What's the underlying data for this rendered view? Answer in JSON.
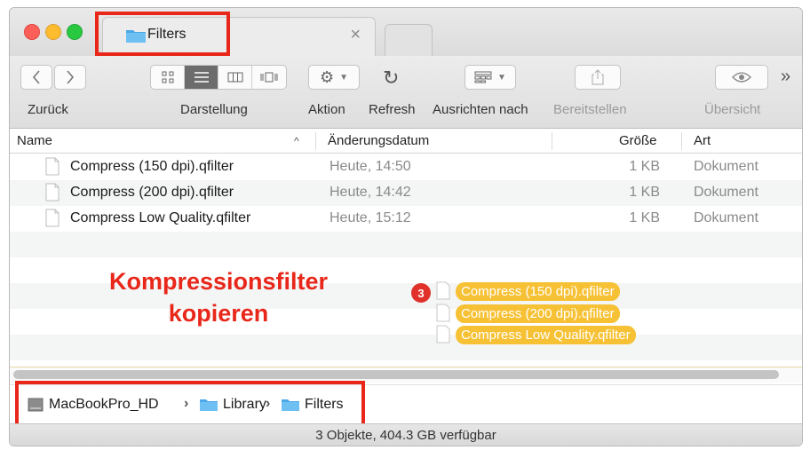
{
  "tab": {
    "title": "Filters",
    "close_glyph": "×"
  },
  "toolbar": {
    "back_label": "Zurück",
    "view_label": "Darstellung",
    "action_label": "Aktion",
    "refresh_label": "Refresh",
    "arrange_label": "Ausrichten nach",
    "share_label": "Bereitstellen",
    "preview_label": "Übersicht",
    "more_glyph": "»"
  },
  "columns": {
    "name": "Name",
    "date": "Änderungsdatum",
    "size": "Größe",
    "kind": "Art",
    "sort_glyph": "^"
  },
  "files": [
    {
      "name": "Compress (150 dpi).qfilter",
      "date": "Heute, 14:50",
      "size": "1 KB",
      "kind": "Dokument"
    },
    {
      "name": "Compress (200 dpi).qfilter",
      "date": "Heute, 14:42",
      "size": "1 KB",
      "kind": "Dokument"
    },
    {
      "name": "Compress Low Quality.qfilter",
      "date": "Heute, 15:12",
      "size": "1 KB",
      "kind": "Dokument"
    }
  ],
  "annotation": {
    "line1": "Kompressionsfilter",
    "line2": "kopieren"
  },
  "drag": {
    "count": "3",
    "items": [
      "Compress (150 dpi).qfilter",
      "Compress (200 dpi).qfilter",
      "Compress Low Quality.qfilter"
    ]
  },
  "path": {
    "disk": "MacBookPro_HD",
    "folder1": "Library",
    "folder2": "Filters",
    "separator": "›"
  },
  "status": "3 Objekte, 404.3 GB verfügbar",
  "colors": {
    "highlight": "#e8271a",
    "folder": "#4aa8e8",
    "drag_pill": "#f6c135"
  }
}
